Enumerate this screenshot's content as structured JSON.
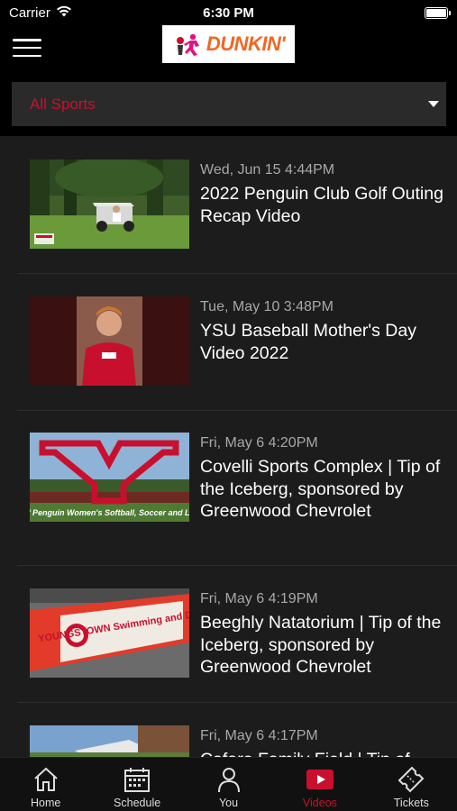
{
  "status": {
    "carrier": "Carrier",
    "time": "6:30 PM"
  },
  "header": {
    "logo_text": "DUNKIN'",
    "logo_icon": "running-penguin-icon"
  },
  "filter": {
    "selected": "All Sports"
  },
  "videos": [
    {
      "date": "Wed, Jun 15 4:44PM",
      "title": "2022 Penguin Club Golf Outing Recap Video"
    },
    {
      "date": "Tue, May 10 3:48PM",
      "title": "YSU Baseball Mother's Day Video 2022"
    },
    {
      "date": "Fri, May 6 4:20PM",
      "title": "Covelli Sports Complex | Tip of the Iceberg, sponsored by Greenwood Chevrolet",
      "thumb_caption": "Home of Penguin Women's Softball, Soccer and Lacrosse"
    },
    {
      "date": "Fri, May 6 4:19PM",
      "title": "Beeghly Natatorium | Tip of the Iceberg, sponsored by Greenwood Chevrolet",
      "thumb_caption": "YOUNGSTOWN Swimming and Diving"
    },
    {
      "date": "Fri, May 6 4:17PM",
      "title": "Cafaro Family Field | Tip of"
    }
  ],
  "tabs": [
    {
      "label": "Home",
      "icon": "home-icon"
    },
    {
      "label": "Schedule",
      "icon": "calendar-icon"
    },
    {
      "label": "You",
      "icon": "person-icon"
    },
    {
      "label": "Videos",
      "icon": "video-play-icon",
      "active": true
    },
    {
      "label": "Tickets",
      "icon": "ticket-icon"
    }
  ],
  "colors": {
    "accent": "#c8102e",
    "background": "#1c1c1c",
    "bar": "#000000",
    "brand_orange": "#f26722",
    "brand_pink": "#e11383"
  }
}
